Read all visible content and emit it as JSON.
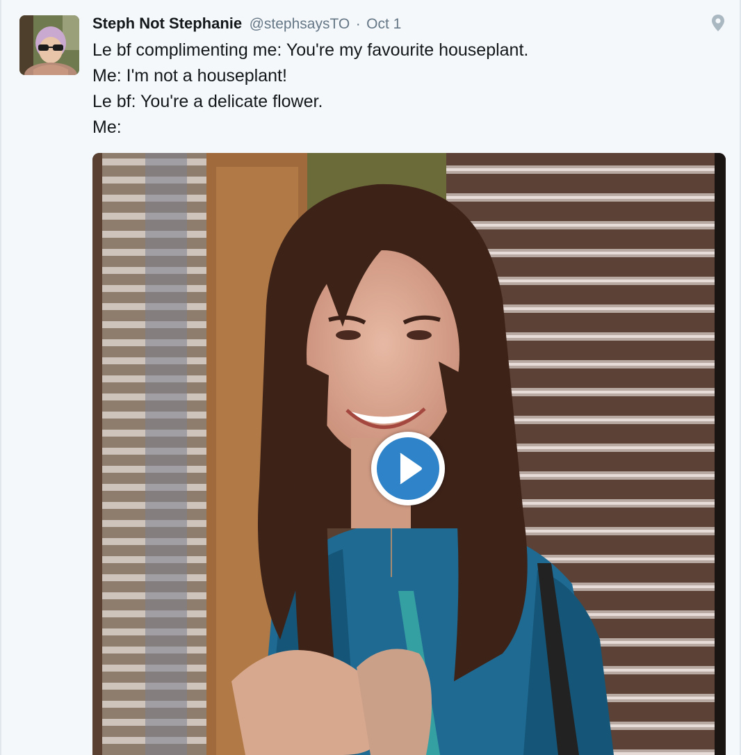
{
  "tweet": {
    "author_name": "Steph Not Stephanie",
    "author_handle": "@stephsaysTO",
    "separator": "·",
    "timestamp": "Oct 1",
    "lines": [
      "Le bf complimenting me: You're my favourite houseplant.",
      "Me: I'm not a houseplant!",
      "Le bf: You're a delicate flower.",
      "Me:"
    ],
    "avatar_icon": "user-avatar",
    "location_icon": "map-pin-icon"
  },
  "media": {
    "type": "video",
    "play_icon": "play-icon",
    "accent_color": "#2f83c8"
  },
  "colors": {
    "name": "#14171a",
    "secondary": "#657786",
    "background": "#f5f8fa"
  }
}
